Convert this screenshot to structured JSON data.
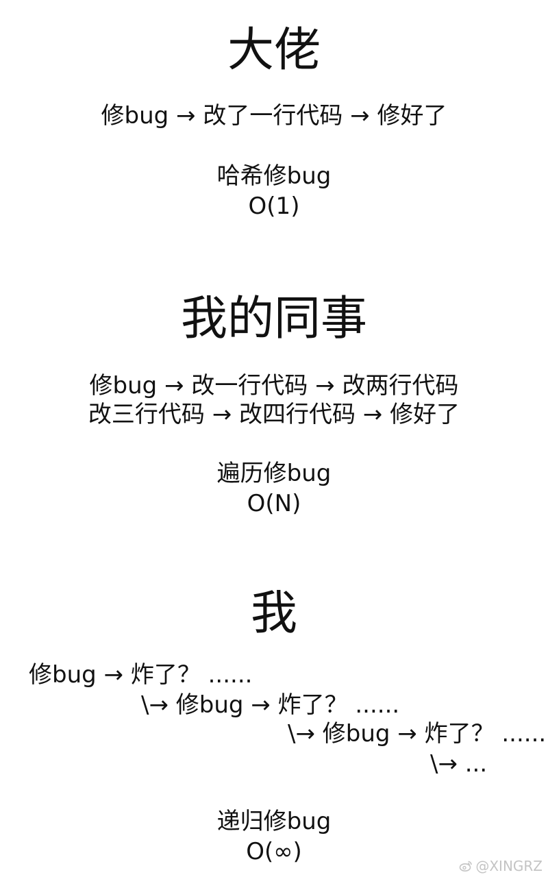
{
  "section_1": {
    "heading": "大佬",
    "steps": "修bug → 改了一行代码 → 修好了",
    "method": "哈希修bug",
    "complexity": "O(1)"
  },
  "section_2": {
    "heading": "我的同事",
    "steps_line_1": "修bug → 改一行代码 → 改两行代码",
    "steps_line_2": "改三行代码 → 改四行代码 → 修好了",
    "method": "遍历修bug",
    "complexity": "O(N)"
  },
  "section_3": {
    "heading": "我",
    "recursion_lines": [
      "修bug → 炸了？ ......",
      "\\→ 修bug → 炸了？ ......",
      "\\→ 修bug → 炸了？ ......",
      "\\→ ..."
    ],
    "method": "递归修bug",
    "complexity": "O(∞)"
  },
  "watermark": {
    "text": "@XINGRZ",
    "icon": "weibo-icon"
  }
}
